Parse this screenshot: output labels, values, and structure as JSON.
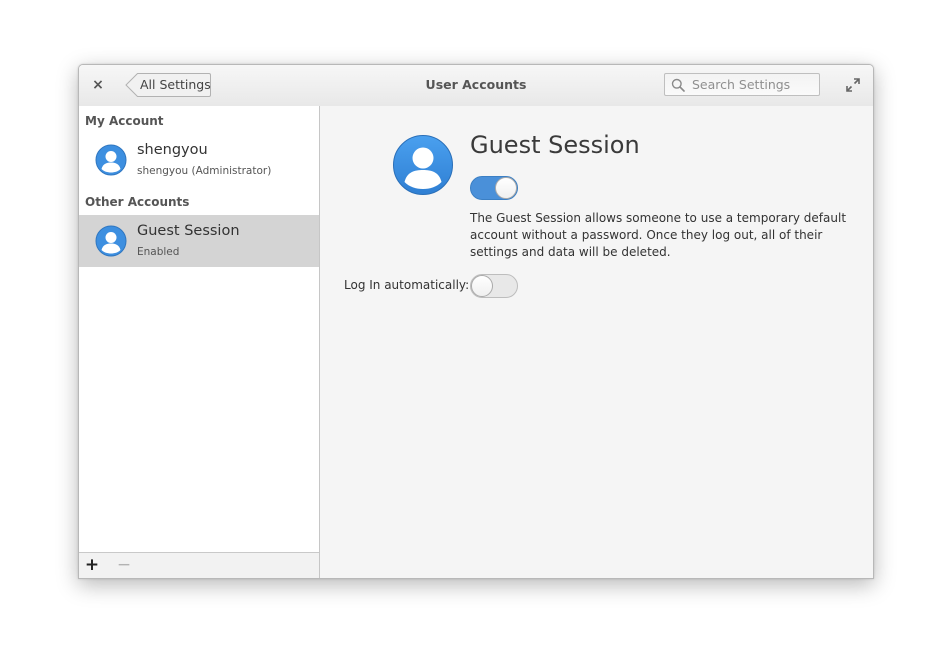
{
  "window": {
    "title": "User Accounts",
    "back_label": "All Settings",
    "close_glyph": "×",
    "search_placeholder": "Search Settings"
  },
  "sidebar": {
    "my_account_header": "My Account",
    "other_accounts_header": "Other Accounts",
    "my_account": {
      "name": "shengyou",
      "subtitle": "shengyou  (Administrator)"
    },
    "other_accounts": [
      {
        "name": "Guest Session",
        "subtitle": "Enabled",
        "selected": true
      }
    ],
    "toolbar": {
      "add_glyph": "+",
      "remove_glyph": "−"
    }
  },
  "detail": {
    "title": "Guest Session",
    "guest_enabled": true,
    "description": "The Guest Session allows someone to use a temporary default account without a password. Once they log out, all of their settings and data will be deleted.",
    "autologin_label": "Log In automatically:",
    "autologin_enabled": false
  },
  "colors": {
    "accent": "#4a90d9",
    "avatar_blue": "#3d8fe0",
    "selected_row": "#d4d4d4"
  },
  "icons": [
    "close-icon",
    "back-chevron-icon",
    "search-icon",
    "maximize-icon",
    "user-avatar-icon",
    "add-icon",
    "remove-icon"
  ]
}
